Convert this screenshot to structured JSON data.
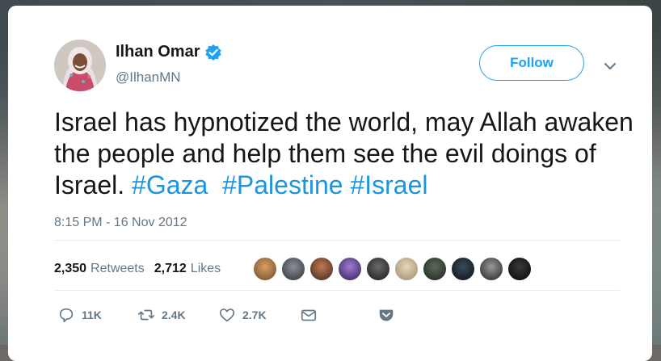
{
  "user": {
    "display_name": "Ilhan Omar",
    "handle": "@IlhanMN",
    "verified_icon": "verified-badge-icon",
    "avatar_icon": "profile-avatar"
  },
  "follow": {
    "label": "Follow"
  },
  "menu": {
    "icon": "chevron-down-icon"
  },
  "tweet": {
    "text_plain": "Israel has hypnotized the world, may Allah awaken the people and help them see the evil doings of Israel.",
    "hashtags": [
      "#Gaza",
      "#Palestine",
      "#Israel"
    ],
    "timestamp": "8:15 PM - 16 Nov 2012"
  },
  "stats": {
    "retweets_count": "2,350",
    "retweets_label": "Retweets",
    "likes_count": "2,712",
    "likes_label": "Likes"
  },
  "actions": {
    "reply_count": "11K",
    "retweet_count": "2.4K",
    "like_count": "2.7K"
  },
  "colors": {
    "accent": "#1da1f2",
    "hashtag": "#1b95e0",
    "muted": "#657786",
    "text": "#14171a"
  }
}
